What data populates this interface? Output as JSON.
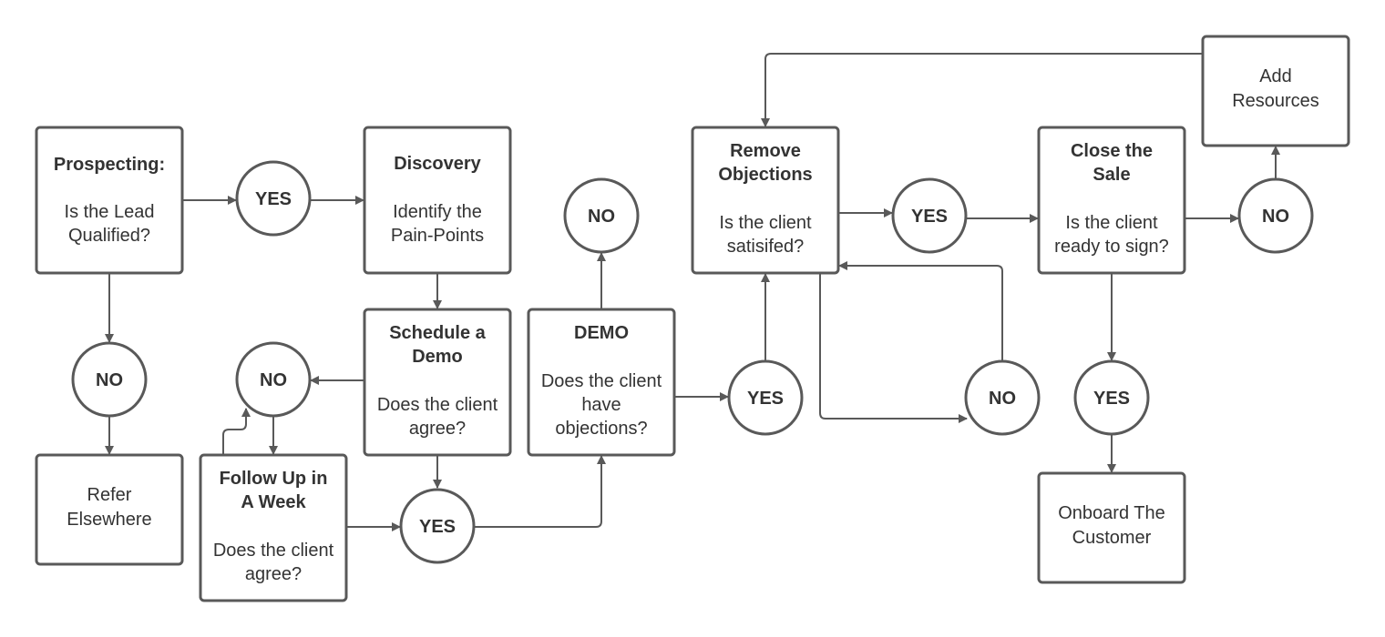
{
  "nodes": {
    "prospecting": {
      "title": "Prospecting:",
      "lines": [
        "Is the Lead",
        "Qualified?"
      ]
    },
    "discovery": {
      "title": "Discovery",
      "lines": [
        "Identify the",
        "Pain-Points"
      ]
    },
    "schedule": {
      "title": [
        "Schedule a",
        "Demo"
      ],
      "lines": [
        "Does the client",
        "agree?"
      ]
    },
    "demo": {
      "title": "DEMO",
      "lines": [
        "Does the client",
        "have",
        "objections?"
      ]
    },
    "follow_up": {
      "title": [
        "Follow Up in",
        "A Week"
      ],
      "lines": [
        "Does the client",
        "agree?"
      ]
    },
    "refer": {
      "lines": [
        "Refer",
        "Elsewhere"
      ]
    },
    "remove": {
      "title": [
        "Remove",
        "Objections"
      ],
      "lines": [
        "Is the client",
        "satisifed?"
      ]
    },
    "close": {
      "title": [
        "Close the",
        "Sale"
      ],
      "lines": [
        "Is the client",
        "ready to sign?"
      ]
    },
    "add_resources": {
      "lines": [
        "Add",
        "Resources"
      ]
    },
    "onboard": {
      "lines": [
        "Onboard The",
        "Customer"
      ]
    }
  },
  "decisions": {
    "yes": "YES",
    "no": "NO"
  },
  "colors": {
    "stroke": "#595959",
    "text": "#333333"
  }
}
